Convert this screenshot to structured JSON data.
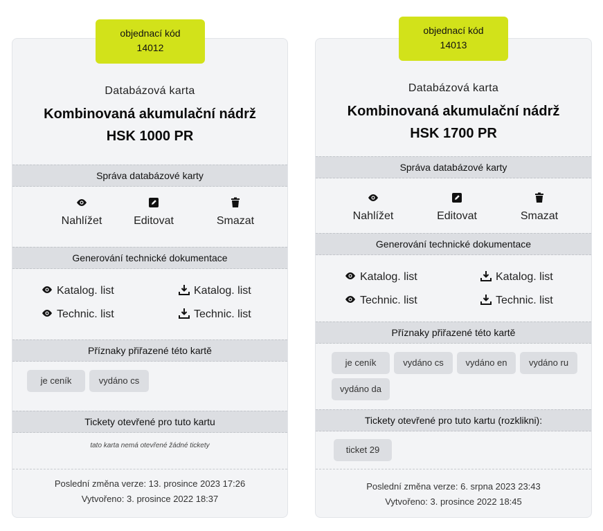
{
  "cards": [
    {
      "order_code_label": "objednací kód",
      "order_code": "14012",
      "subtitle": "Databázová karta",
      "title_line1": "Kombinovaná akumulační nádrž",
      "title_line2": "HSK 1000 PR",
      "manage_header": "Správa databázové karty",
      "actions": {
        "view": "Nahlížet",
        "edit": "Editovat",
        "delete": "Smazat"
      },
      "docs_header": "Generování technické dokumentace",
      "docs": {
        "view_catalog": "Katalog. list",
        "download_catalog": "Katalog. list",
        "view_technical": "Technic. list",
        "download_technical": "Technic. list"
      },
      "flags_header": "Příznaky přiřazené této kartě",
      "flags": [
        "je ceník",
        "vydáno cs"
      ],
      "tickets_header": "Tickety otevřené pro tuto kartu",
      "tickets_note": "tato karta nemá otevřené žádné tickety",
      "tickets": [],
      "last_change": "Poslední změna verze: 13. prosince 2023 17:26",
      "created": "Vytvořeno: 3. prosince 2022 18:37"
    },
    {
      "order_code_label": "objednací kód",
      "order_code": "14013",
      "subtitle": "Databázová karta",
      "title_line1": "Kombinovaná akumulační nádrž",
      "title_line2": "HSK 1700 PR",
      "manage_header": "Správa databázové karty",
      "actions": {
        "view": "Nahlížet",
        "edit": "Editovat",
        "delete": "Smazat"
      },
      "docs_header": "Generování technické dokumentace",
      "docs": {
        "view_catalog": "Katalog. list",
        "download_catalog": "Katalog. list",
        "view_technical": "Technic. list",
        "download_technical": "Technic. list"
      },
      "flags_header": "Příznaky přiřazené této kartě",
      "flags": [
        "je ceník",
        "vydáno cs",
        "vydáno en",
        "vydáno ru",
        "vydáno da"
      ],
      "tickets_header": "Tickety otevřené pro tuto kartu (rozklikni):",
      "tickets": [
        "ticket 29"
      ],
      "last_change": "Poslední změna verze: 6. srpna 2023 23:43",
      "created": "Vytvořeno: 3. prosince 2022 18:45"
    }
  ],
  "colors": {
    "badge": "#d2e21a",
    "card_bg": "#f3f4f6",
    "band_bg": "#dcdee2",
    "tag_bg": "#dcdee2"
  },
  "icons": {
    "view": "eye-icon",
    "edit": "pencil-square-icon",
    "delete": "trash-icon",
    "download": "download-icon"
  }
}
